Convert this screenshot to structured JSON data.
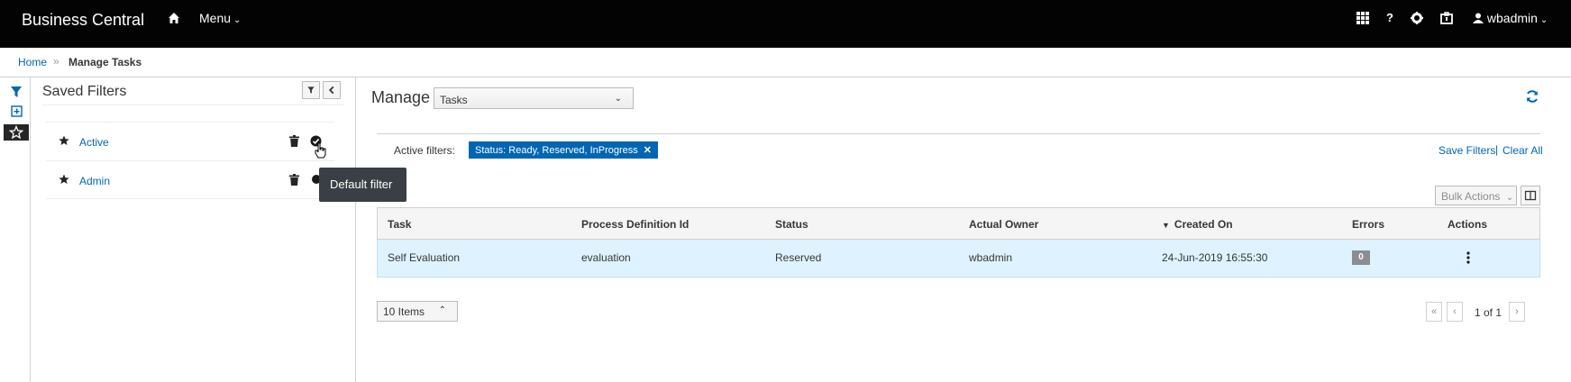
{
  "navbar": {
    "brand": "Business Central",
    "home_icon": "home-icon",
    "menu_label": "Menu",
    "apps_icon": "apps-grid-icon",
    "help_label": "?",
    "settings_icon": "gear-icon",
    "tasks_icon": "briefcase-icon",
    "user_label": "wbadmin"
  },
  "breadcrumb": {
    "home": "Home",
    "separator": "»",
    "current": "Manage Tasks"
  },
  "sidebar_icons": [
    "filter-icon",
    "plus-square-icon",
    "star-icon"
  ],
  "saved_filters": {
    "title": "Saved Filters",
    "items": [
      {
        "label": "Active"
      },
      {
        "label": "Admin"
      }
    ],
    "tooltip": "Default filter"
  },
  "main": {
    "title": "Manage",
    "view_select": "Tasks",
    "active_filters_label": "Active filters:",
    "active_filter_chip": "Status: Ready, Reserved, InProgress",
    "save_filters": "Save Filters",
    "separator": "|",
    "clear_all": "Clear All",
    "bulk_actions": "Bulk Actions",
    "columns": [
      "Task",
      "Process Definition Id",
      "Status",
      "Actual Owner",
      "Created On",
      "Errors",
      "Actions"
    ],
    "rows": [
      {
        "task": "Self Evaluation",
        "process": "evaluation",
        "status": "Reserved",
        "owner": "wbadmin",
        "created": "24-Jun-2019 16:55:30",
        "errors": "0"
      }
    ],
    "items_per_page": "10 Items",
    "page_info": "1 of 1"
  },
  "colors": {
    "navbar": "#030303",
    "link": "#0066b3",
    "row_highlight": "#def3ff",
    "chip": "#0066b3"
  }
}
